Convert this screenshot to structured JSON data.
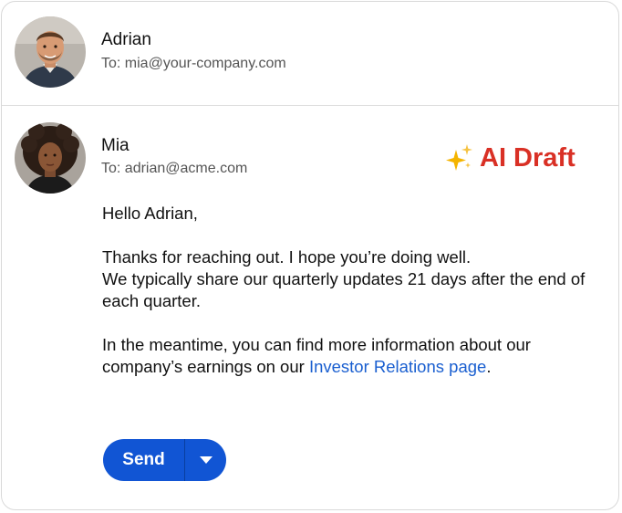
{
  "incoming": {
    "sender_name": "Adrian",
    "to_line": "To: mia@your-company.com",
    "avatar_icon": "person-avatar-man"
  },
  "reply": {
    "sender_name": "Mia",
    "to_line": "To: adrian@acme.com",
    "avatar_icon": "person-avatar-woman",
    "badge": {
      "icon": "sparkles-icon",
      "label": "AI Draft",
      "color": "#d93025"
    },
    "greeting": "Hello Adrian,",
    "para1_line1": "Thanks for reaching out. I hope you’re doing well.",
    "para1_line2": "We typically share our quarterly updates 21 days after the end of each quarter.",
    "para2_before_link": "In the meantime, you can find more information about our company’s earnings on our ",
    "para2_link": "Investor Relations page",
    "para2_after_link": ".",
    "link_color": "#1a5fd0"
  },
  "actions": {
    "send_label": "Send",
    "send_menu_icon": "caret-down-icon",
    "button_color": "#1155d4"
  }
}
